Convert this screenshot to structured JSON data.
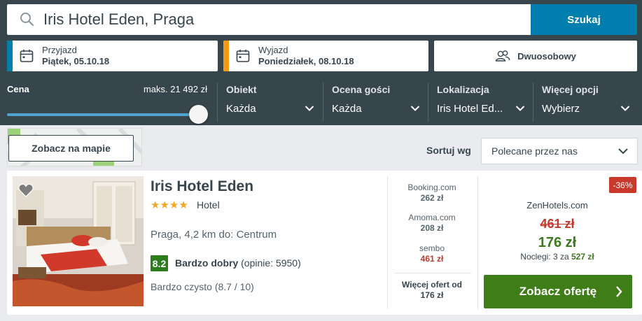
{
  "search": {
    "query": "Iris Hotel Eden, Praga",
    "button_label": "Szukaj"
  },
  "checkin": {
    "label": "Przyjazd",
    "value": "Piątek, 05.10.18",
    "accent": "#007faf"
  },
  "checkout": {
    "label": "Wyjazd",
    "value": "Poniedziałek, 08.10.18",
    "accent": "#f39c12"
  },
  "room": {
    "label": "Dwuosobowy"
  },
  "filters": {
    "price": {
      "label": "Cena",
      "max_label": "maks. 21 492 zł",
      "slider_fraction": 1.0
    },
    "object": {
      "label": "Obiekt",
      "value": "Każda"
    },
    "rating": {
      "label": "Ocena gości",
      "value": "Każda"
    },
    "location": {
      "label": "Lokalizacja",
      "value": "Iris Hotel Ed..."
    },
    "more": {
      "label": "Więcej opcji",
      "value": "Wybierz"
    }
  },
  "map": {
    "button_label": "Zobacz na mapie"
  },
  "sort": {
    "label": "Sortuj wg",
    "value": "Polecane przez nas"
  },
  "hotel": {
    "name": "Iris Hotel Eden",
    "stars": "★★★★",
    "star_count": 4,
    "type": "Hotel",
    "location": "Praga, 4,2 km do: Centrum",
    "score": "8.2",
    "rating_word": "Bardzo dobry",
    "reviews": "(opinie: 5950)",
    "clean": "Bardzo czysto (8.7 / 10)",
    "providers": [
      {
        "name": "Booking.com",
        "price": "262 zł"
      },
      {
        "name": "Amoma.com",
        "price": "208 zł"
      },
      {
        "name": "sembo",
        "price": "461 zł"
      }
    ],
    "more_offers_line1": "Więcej ofert od",
    "more_offers_line2": "176 zł",
    "discount": "-36%",
    "best_provider": "ZenHotels.com",
    "old_price": "461 zł",
    "new_price": "176 zł",
    "nights_prefix": "Noclegi: 3 za",
    "nights_total": "527 zł",
    "offer_button": "Zobacz ofertę"
  }
}
